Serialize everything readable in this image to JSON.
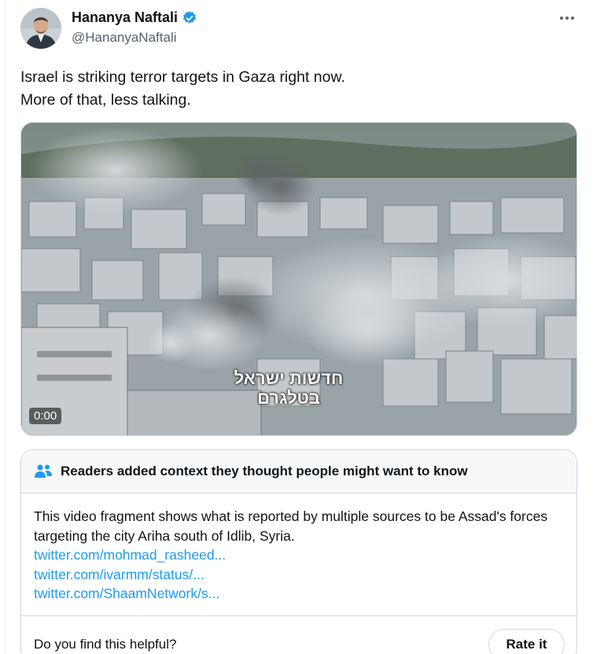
{
  "author": {
    "display_name": "Hananya Naftali",
    "handle": "@HananyaNaftali",
    "verified": true
  },
  "tweet": {
    "line1": "Israel is striking terror targets in Gaza right now.",
    "line2": "More of that, less talking."
  },
  "media": {
    "type": "video",
    "timestamp": "0:00",
    "caption_line1": "חדשות ישראל",
    "caption_line2": "בטלגרם"
  },
  "community_note": {
    "title": "Readers added context they thought people might want to know",
    "body": "This video fragment shows what is reported by multiple sources to be Assad's forces targeting the city Ariha south of Idlib, Syria.",
    "links": [
      "twitter.com/mohmad_rasheed...",
      "twitter.com/ivarmm/status/...",
      "twitter.com/ShaamNetwork/s..."
    ],
    "helpful_question": "Do you find this helpful?",
    "rate_label": "Rate it"
  },
  "icons": {
    "verified": "verified-badge-icon",
    "more": "more-icon",
    "note": "people-icon"
  },
  "colors": {
    "verified": "#1d9bf0",
    "link": "#1d9bf0",
    "secondary_text": "#536471",
    "border": "#cfd9de",
    "note_header_bg": "#f7f9f9"
  }
}
